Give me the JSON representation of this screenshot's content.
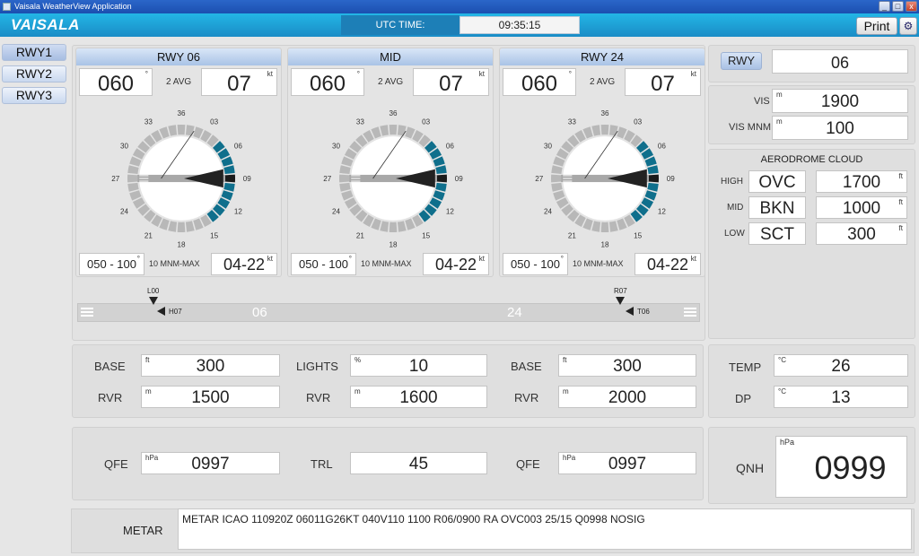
{
  "window": {
    "title": "Vaisala WeatherView Application",
    "min": "_",
    "max": "□",
    "close": "x"
  },
  "header": {
    "logo": "VAISALA",
    "utc_label": "UTC TIME:",
    "utc_value": "09:35:15",
    "print_label": "Print"
  },
  "tabs": [
    "RWY1",
    "RWY2",
    "RWY3"
  ],
  "wind": [
    {
      "title": "RWY 06",
      "dir": "060",
      "dir_unit": "°",
      "avg_label": "2 AVG",
      "speed": "07",
      "speed_unit": "kt",
      "variation": "050 - 100",
      "variation_unit": "°",
      "mnm_max_label": "10 MNM-MAX",
      "gust_range": "04-22",
      "gust_unit": "kt"
    },
    {
      "title": "MID",
      "dir": "060",
      "dir_unit": "°",
      "avg_label": "2 AVG",
      "speed": "07",
      "speed_unit": "kt",
      "variation": "050 - 100",
      "variation_unit": "°",
      "mnm_max_label": "10 MNM-MAX",
      "gust_range": "04-22",
      "gust_unit": "kt"
    },
    {
      "title": "RWY 24",
      "dir": "060",
      "dir_unit": "°",
      "avg_label": "2 AVG",
      "speed": "07",
      "speed_unit": "kt",
      "variation": "050 - 100",
      "variation_unit": "°",
      "mnm_max_label": "10 MNM-MAX",
      "gust_range": "04-22",
      "gust_unit": "kt"
    }
  ],
  "compass_labels": [
    "33",
    "36",
    "03",
    "06",
    "09",
    "12",
    "15",
    "18",
    "21",
    "24",
    "27",
    "30"
  ],
  "runway_strip": {
    "left_label": "06",
    "right_label": "24",
    "markers": [
      "L00",
      "H07",
      "R07",
      "T06"
    ]
  },
  "right": {
    "rwy_button": "RWY",
    "rwy_value": "06",
    "vis_label": "VIS",
    "vis_unit": "m",
    "vis_value": "1900",
    "vis_mnm_label": "VIS MNM",
    "vis_mnm_unit": "m",
    "vis_mnm_value": "100",
    "cloud_title": "AERODROME CLOUD",
    "clouds": [
      {
        "level": "HIGH",
        "type": "OVC",
        "height": "1700",
        "unit": "ft"
      },
      {
        "level": "MID",
        "type": "BKN",
        "height": "1000",
        "unit": "ft"
      },
      {
        "level": "LOW",
        "type": "SCT",
        "height": "300",
        "unit": "ft"
      }
    ]
  },
  "bottom": {
    "col1": {
      "base_label": "BASE",
      "base_unit": "ft",
      "base_value": "300",
      "rvr_label": "RVR",
      "rvr_unit": "m",
      "rvr_value": "1500",
      "qfe_label": "QFE",
      "qfe_unit": "hPa",
      "qfe_value": "0997"
    },
    "col2": {
      "lights_label": "LIGHTS",
      "lights_unit": "%",
      "lights_value": "10",
      "rvr_label": "RVR",
      "rvr_unit": "m",
      "rvr_value": "1600",
      "trl_label": "TRL",
      "trl_value": "45"
    },
    "col3": {
      "base_label": "BASE",
      "base_unit": "ft",
      "base_value": "300",
      "rvr_label": "RVR",
      "rvr_unit": "m",
      "rvr_value": "2000",
      "qfe_label": "QFE",
      "qfe_unit": "hPa",
      "qfe_value": "0997"
    },
    "temp": {
      "temp_label": "TEMP",
      "temp_unit": "°C",
      "temp_value": "26",
      "dp_label": "DP",
      "dp_unit": "°C",
      "dp_value": "13"
    },
    "qnh": {
      "label": "QNH",
      "unit": "hPa",
      "value": "0999"
    }
  },
  "metar": {
    "label": "METAR",
    "text": "METAR ICAO 110920Z 06011G26KT 040V110 1100 R06/0900 RA  OVC003 25/15 Q0998 NOSIG"
  },
  "colors": {
    "header": "#1a9ad6",
    "accent": "#0f6f8c",
    "needle": "#222222"
  }
}
